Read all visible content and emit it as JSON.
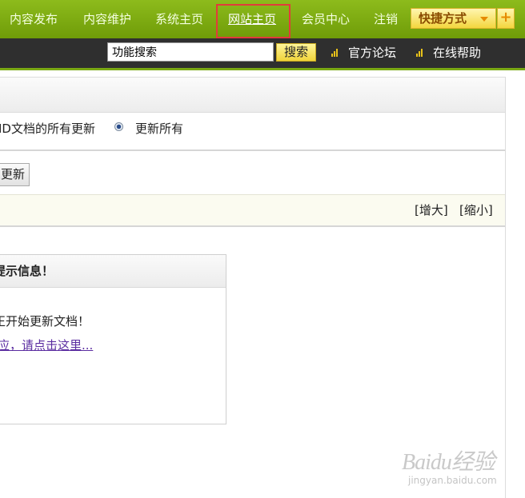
{
  "nav": {
    "items": [
      {
        "label": "内容发布"
      },
      {
        "label": "内容维护"
      },
      {
        "label": "系统主页"
      },
      {
        "label": "网站主页"
      },
      {
        "label": "会员中心"
      },
      {
        "label": "注销"
      }
    ],
    "active_index": 3,
    "quick_label": "快捷方式",
    "quick_plus": "+"
  },
  "toolbar": {
    "search_value": "功能搜索",
    "search_button": "搜索",
    "forum_link": "官方论坛",
    "help_link": "在线帮助"
  },
  "options": {
    "option_a": "ID文档的所有更新",
    "option_b": "更新所有",
    "selected": "更新所有"
  },
  "actions": {
    "update_button": "更新"
  },
  "zoom": {
    "enlarge": "[增大]",
    "shrink": "[缩小]"
  },
  "message": {
    "title": "提示信息！",
    "text": "正开始更新文档！",
    "link": "应，请点击这里..."
  },
  "watermark": {
    "main": "Baidu经验",
    "sub": "jingyan.baidu.com"
  },
  "colors": {
    "nav_green": "#7aa814",
    "toolbar_dark": "#2f2f2f",
    "highlight_red": "#e23b3b",
    "quick_yellow": "#f3d63e"
  }
}
